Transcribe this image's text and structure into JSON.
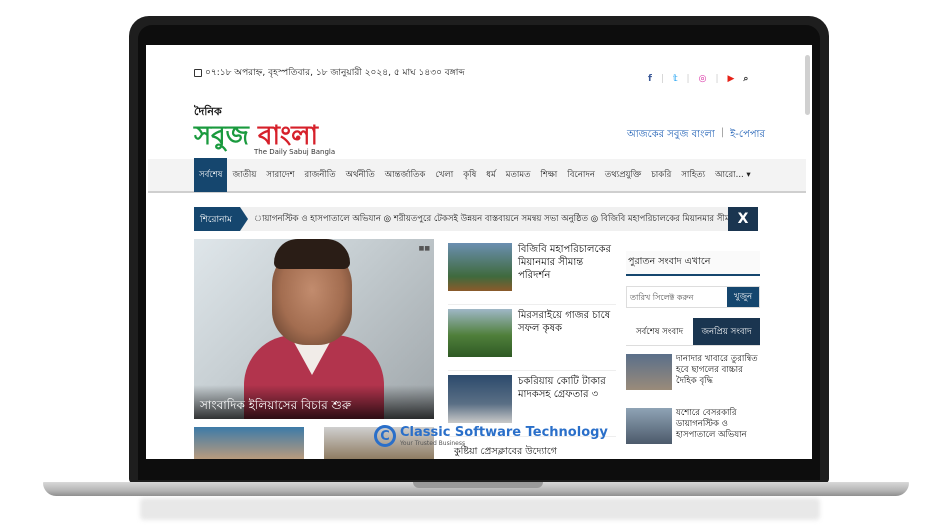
{
  "header": {
    "datetime": "০৭:১৮ অপরাহ্ন, বৃহস্পতিবার, ১৮ জানুয়ারী ২০২৪, ৫ মাঘ ১৪৩০ বঙ্গাব্দ",
    "social_icons": [
      "facebook-icon",
      "twitter-icon",
      "instagram-icon",
      "youtube-icon",
      "search-icon"
    ],
    "social_glyphs": [
      "f",
      "𝕥",
      "◎",
      "▶",
      "⌕"
    ],
    "social_colors": [
      "#3b5998",
      "#1da1f2",
      "#d6249f",
      "#e62117",
      "#333333"
    ]
  },
  "logo": {
    "small": "দৈনিক",
    "main_green": "সবুজ ",
    "main_red": "বাংলা",
    "subtitle": "The Daily Sabuj Bangla"
  },
  "links": {
    "today": "আজকের সবুজ বাংলা",
    "separator": "|",
    "epaper": "ই-পেপার"
  },
  "nav": {
    "items": [
      "সর্বশেষ",
      "জাতীয়",
      "সারাদেশ",
      "রাজনীতি",
      "অর্থনীতি",
      "আন্তর্জাতিক",
      "খেলা",
      "কৃষি",
      "ধর্ম",
      "মতামত",
      "শিক্ষা",
      "বিনোদন",
      "তথ্যপ্রযুক্তি",
      "চাকরি",
      "সাহিত্য",
      "আরো... ▾"
    ],
    "active_index": 0
  },
  "ticker": {
    "label": "শিরোনাম",
    "text": "ায়াগনস্টিক ও হাসপাতালে অভিযান  ◎ শরীয়তপুরে টেকসই উন্নয়ন বাস্তবায়নে সমন্বয় সভা অনুষ্ঠিত  ◎ বিজিবি মহাপরিচালকের মিয়ানমার সীমান্ত পরিদর্শন",
    "close": "X"
  },
  "hero": {
    "caption": "সাংবাদিক ইলিয়াসের বিচার শুরু",
    "dots": "■■"
  },
  "mid_news": [
    {
      "title": "বিজিবি মহাপরিচালকের মিয়ানমার সীমান্ত পরিদর্শন"
    },
    {
      "title": "মিরসরাইয়ে গাজর চাষে সফল কৃষক"
    },
    {
      "title": "চকরিয়ায় কোটি টাকার মাদকসহ গ্রেফতার ৩"
    }
  ],
  "bottom_news": {
    "title": "কুষ্টিয়া প্রেসক্লাবের উদ্যোগে"
  },
  "watermark": {
    "letter": "C",
    "text": "Classic Software Technology",
    "sub": "Your Trusted Business"
  },
  "sidebar": {
    "archive_title": "পুরাতন সংবাদ এখানে",
    "date_placeholder": "তারিখ সিলেক্ট করুন",
    "search_button": "খুজুন",
    "tabs": [
      "সর্বশেষ সংবাদ",
      "জনপ্রিয় সংবাদ"
    ],
    "news": [
      {
        "title": "দানাদার খাবারে তুরান্বিত হবে ছাগলের বাচ্চার দৈহিক বৃদ্ধি"
      },
      {
        "title": "যশোরে বেসরকারি ডায়াগনস্টিক ও হাসপাতালে অভিযান"
      }
    ]
  }
}
